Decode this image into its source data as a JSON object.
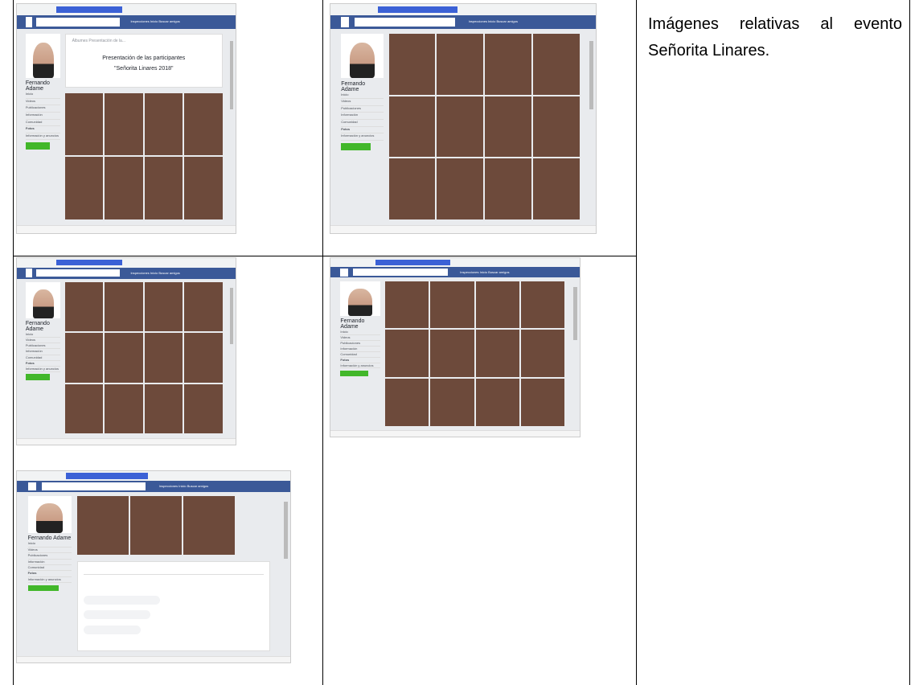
{
  "description": "Imágenes relativas al evento Señorita Linares.",
  "screenshots": [
    {
      "profile_name": "Fernando Adame",
      "album_title": "Presentación de las participantes",
      "album_subtitle": "\"Señorita Linares 2018\"",
      "breadcrumb": "Álbumes  Presentación de la..."
    },
    {
      "profile_name": "Fernando Adame"
    },
    {
      "profile_name": "Fernando Adame"
    },
    {
      "profile_name": "Fernando Adame"
    },
    {
      "profile_name": "Fernando Adame"
    }
  ],
  "fb_nav": "Inspecciones  Inicio  Buscar amigos",
  "sidebar_items": [
    "Inicio",
    "Videos",
    "Publicaciones",
    "Información",
    "Comunidad",
    "Fotos",
    "Información y anuncios"
  ],
  "colors": {
    "fb_blue": "#3b5998",
    "green": "#42b72a"
  }
}
